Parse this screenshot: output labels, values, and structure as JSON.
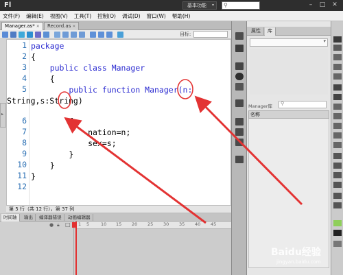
{
  "app": {
    "logo": "Fl",
    "workspace": "基本功能",
    "window_controls": {
      "minimize": "–",
      "maximize": "□",
      "close": "✕"
    }
  },
  "menu": [
    "文件(F)",
    "编辑(E)",
    "视图(V)",
    "工具(T)",
    "控制(O)",
    "调试(D)",
    "窗口(W)",
    "帮助(H)"
  ],
  "doc_tabs": [
    {
      "label": "Manager.as*",
      "active": true
    },
    {
      "label": "Record.as",
      "active": false
    }
  ],
  "editor_toolbar": {
    "target_label": "目标:"
  },
  "code": {
    "lines": [
      {
        "n": "1",
        "text": "package"
      },
      {
        "n": "2",
        "text": "{"
      },
      {
        "n": "3",
        "text": "    public class Manager"
      },
      {
        "n": "4",
        "text": "    {"
      },
      {
        "n": "5",
        "text": "        public function Manager(n:"
      },
      {
        "n": "",
        "text": "String,s:String)"
      },
      {
        "n": "6",
        "text": "        {"
      },
      {
        "n": "7",
        "text": "            nation=n;"
      },
      {
        "n": "8",
        "text": "            sex=s;"
      },
      {
        "n": "9",
        "text": "        }"
      },
      {
        "n": "10",
        "text": "    }"
      },
      {
        "n": "11",
        "text": "}"
      },
      {
        "n": "12",
        "text": ""
      }
    ]
  },
  "status": "第 5 行（共 12 行），第 37 列",
  "bottom_tabs": [
    "时间轴",
    "输出",
    "编译器错误",
    "动画编辑器"
  ],
  "timeline": {
    "frames": [
      "1",
      "5",
      "10",
      "15",
      "20",
      "25",
      "30",
      "35",
      "40",
      "45"
    ]
  },
  "right_panel": {
    "tabs": [
      "属性",
      "库"
    ],
    "library_name": "Manager库",
    "column_header": "名称"
  },
  "watermark": {
    "text": "Baidu经验",
    "sub": "jingyan.baidu.com"
  },
  "colors": {
    "keyword": "#2a2ad0",
    "line_number": "#2a6fb3",
    "annotation": "#e33333",
    "playhead": "#e23030"
  }
}
